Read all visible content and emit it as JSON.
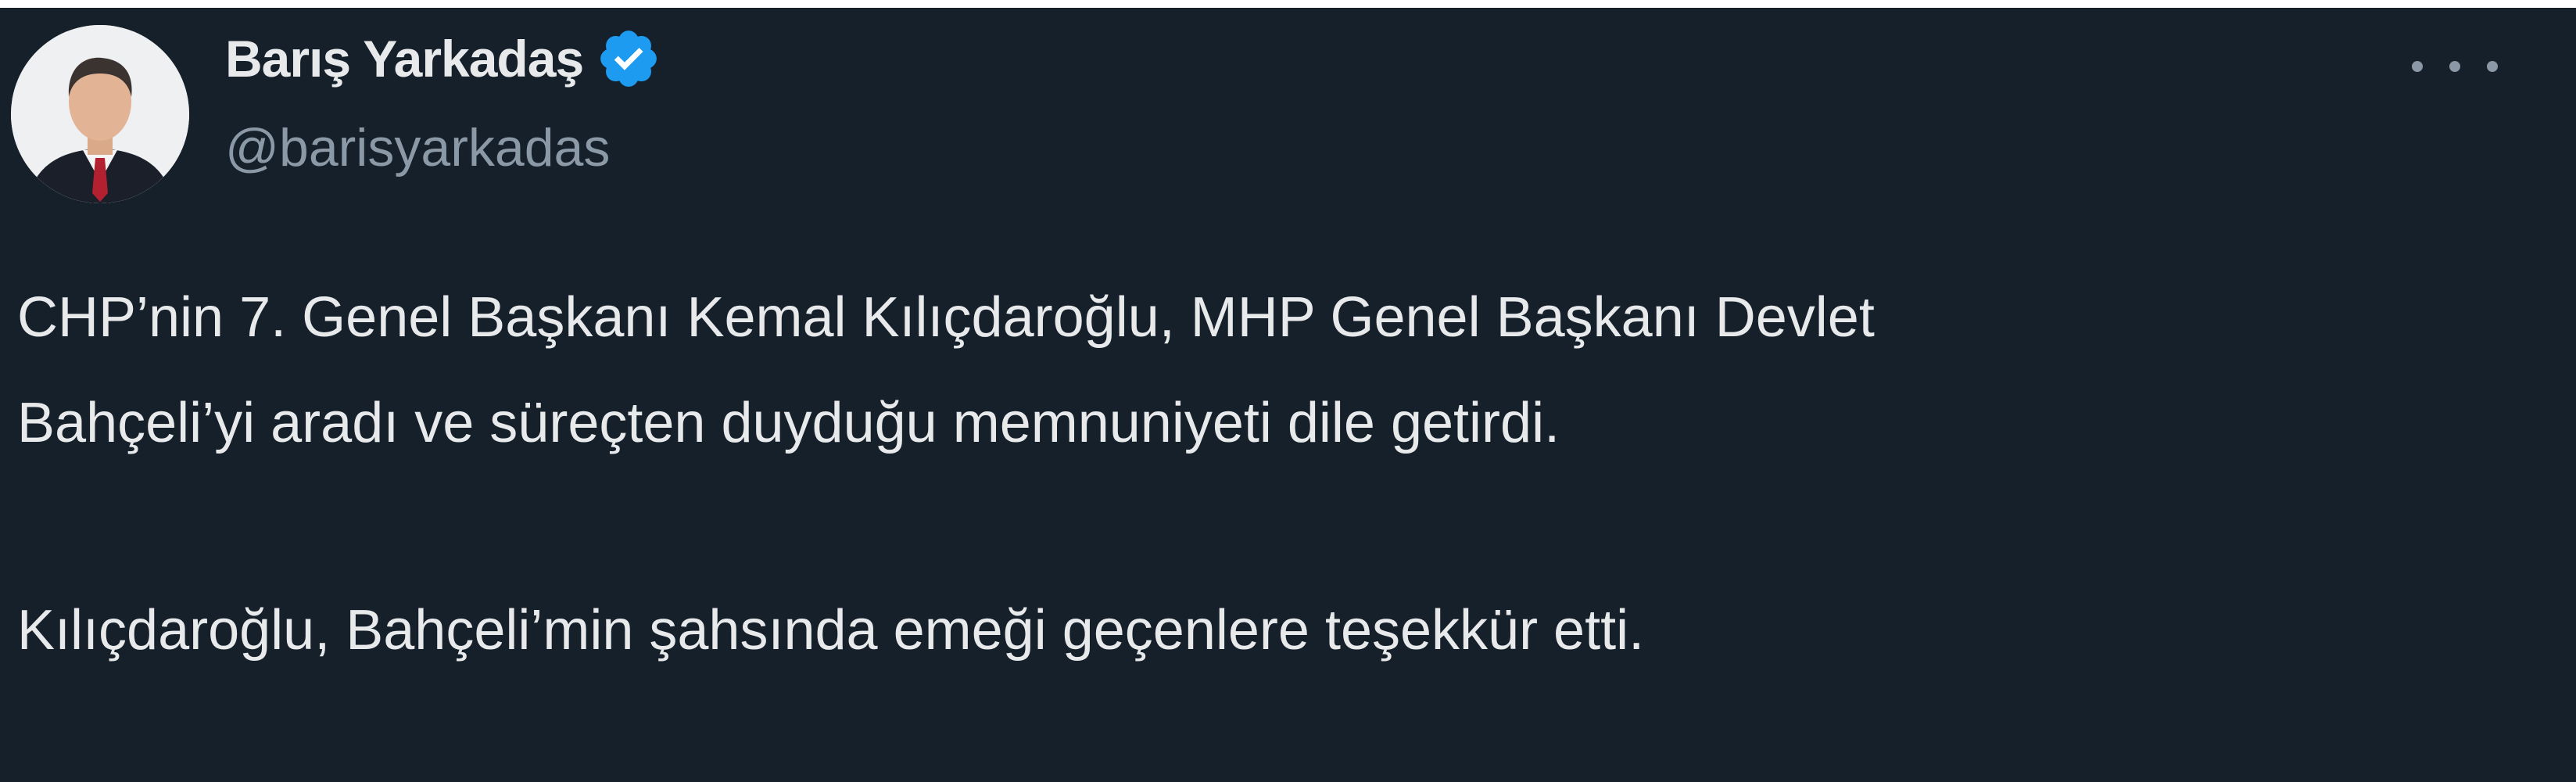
{
  "author": {
    "display_name": "Barış Yarkadaş",
    "handle": "@barisyarkadas",
    "verified": true,
    "avatar_icon": "profile-photo",
    "verified_icon": "verified-badge-icon",
    "verified_color": "#1d9bf0"
  },
  "menu_icon": "more-options-icon",
  "tweet": {
    "lines": [
      "CHP’nin 7. Genel Başkanı Kemal Kılıçdaroğlu, MHP Genel Başkanı Devlet",
      "Bahçeli’yi aradı ve süreçten duyduğu memnuniyeti dile getirdi.",
      "Kılıçdaroğlu, Bahçeli’min şahsında emeği geçenlere teşekkür etti."
    ]
  },
  "colors": {
    "background": "#15202b",
    "text_primary": "#e7e9ea",
    "text_secondary": "#8b98a5"
  }
}
